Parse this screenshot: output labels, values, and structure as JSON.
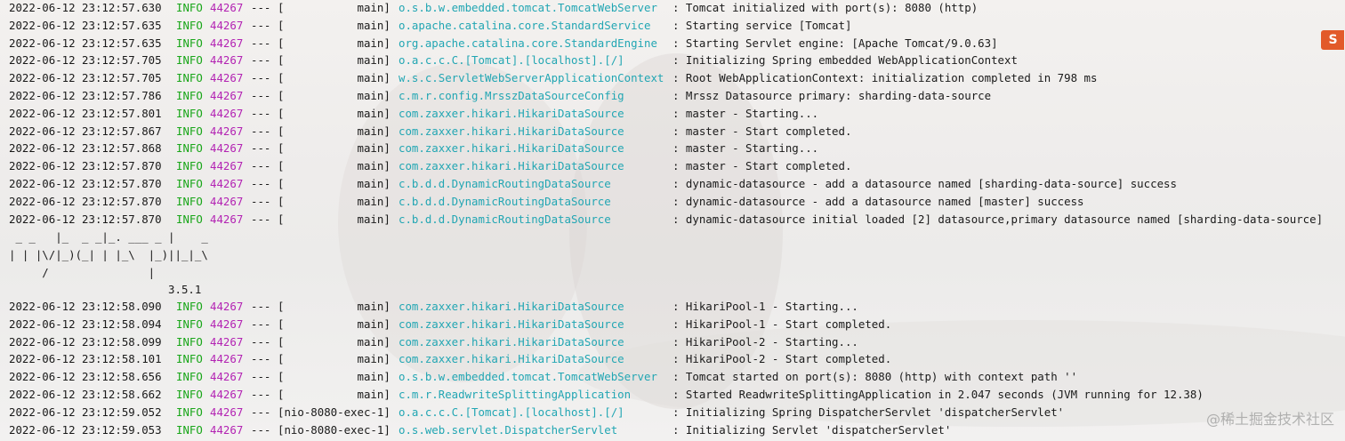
{
  "log_lines_top": [
    {
      "ts": "2022-06-12 23:12:57.630",
      "level": "INFO",
      "pid": "44267",
      "sep": "---",
      "thread": "[           main]",
      "logger": "o.s.b.w.embedded.tomcat.TomcatWebServer",
      "msg": ": Tomcat initialized with port(s): 8080 (http)"
    },
    {
      "ts": "2022-06-12 23:12:57.635",
      "level": "INFO",
      "pid": "44267",
      "sep": "---",
      "thread": "[           main]",
      "logger": "o.apache.catalina.core.StandardService",
      "msg": ": Starting service [Tomcat]"
    },
    {
      "ts": "2022-06-12 23:12:57.635",
      "level": "INFO",
      "pid": "44267",
      "sep": "---",
      "thread": "[           main]",
      "logger": "org.apache.catalina.core.StandardEngine",
      "msg": ": Starting Servlet engine: [Apache Tomcat/9.0.63]"
    },
    {
      "ts": "2022-06-12 23:12:57.705",
      "level": "INFO",
      "pid": "44267",
      "sep": "---",
      "thread": "[           main]",
      "logger": "o.a.c.c.C.[Tomcat].[localhost].[/]",
      "msg": ": Initializing Spring embedded WebApplicationContext"
    },
    {
      "ts": "2022-06-12 23:12:57.705",
      "level": "INFO",
      "pid": "44267",
      "sep": "---",
      "thread": "[           main]",
      "logger": "w.s.c.ServletWebServerApplicationContext",
      "msg": ": Root WebApplicationContext: initialization completed in 798 ms"
    },
    {
      "ts": "2022-06-12 23:12:57.786",
      "level": "INFO",
      "pid": "44267",
      "sep": "---",
      "thread": "[           main]",
      "logger": "c.m.r.config.MrsszDataSourceConfig",
      "msg": ": Mrssz Datasource primary: sharding-data-source"
    },
    {
      "ts": "2022-06-12 23:12:57.801",
      "level": "INFO",
      "pid": "44267",
      "sep": "---",
      "thread": "[           main]",
      "logger": "com.zaxxer.hikari.HikariDataSource",
      "msg": ": master - Starting..."
    },
    {
      "ts": "2022-06-12 23:12:57.867",
      "level": "INFO",
      "pid": "44267",
      "sep": "---",
      "thread": "[           main]",
      "logger": "com.zaxxer.hikari.HikariDataSource",
      "msg": ": master - Start completed."
    },
    {
      "ts": "2022-06-12 23:12:57.868",
      "level": "INFO",
      "pid": "44267",
      "sep": "---",
      "thread": "[           main]",
      "logger": "com.zaxxer.hikari.HikariDataSource",
      "msg": ": master - Starting..."
    },
    {
      "ts": "2022-06-12 23:12:57.870",
      "level": "INFO",
      "pid": "44267",
      "sep": "---",
      "thread": "[           main]",
      "logger": "com.zaxxer.hikari.HikariDataSource",
      "msg": ": master - Start completed."
    },
    {
      "ts": "2022-06-12 23:12:57.870",
      "level": "INFO",
      "pid": "44267",
      "sep": "---",
      "thread": "[           main]",
      "logger": "c.b.d.d.DynamicRoutingDataSource",
      "msg": ": dynamic-datasource - add a datasource named [sharding-data-source] success"
    },
    {
      "ts": "2022-06-12 23:12:57.870",
      "level": "INFO",
      "pid": "44267",
      "sep": "---",
      "thread": "[           main]",
      "logger": "c.b.d.d.DynamicRoutingDataSource",
      "msg": ": dynamic-datasource - add a datasource named [master] success"
    },
    {
      "ts": "2022-06-12 23:12:57.870",
      "level": "INFO",
      "pid": "44267",
      "sep": "---",
      "thread": "[           main]",
      "logger": "c.b.d.d.DynamicRoutingDataSource",
      "msg": ": dynamic-datasource initial loaded [2] datasource,primary datasource named [sharding-data-source]"
    }
  ],
  "banner": {
    "line1": " _ _   |_  _ _|_. ___ _ |    _",
    "line2": "| | |\\/|_)(_| | |_\\  |_)||_|_\\",
    "line3": "     /               |",
    "version": "                        3.5.1"
  },
  "log_lines_bottom": [
    {
      "ts": "2022-06-12 23:12:58.090",
      "level": "INFO",
      "pid": "44267",
      "sep": "---",
      "thread": "[           main]",
      "logger": "com.zaxxer.hikari.HikariDataSource",
      "msg": ": HikariPool-1 - Starting..."
    },
    {
      "ts": "2022-06-12 23:12:58.094",
      "level": "INFO",
      "pid": "44267",
      "sep": "---",
      "thread": "[           main]",
      "logger": "com.zaxxer.hikari.HikariDataSource",
      "msg": ": HikariPool-1 - Start completed."
    },
    {
      "ts": "2022-06-12 23:12:58.099",
      "level": "INFO",
      "pid": "44267",
      "sep": "---",
      "thread": "[           main]",
      "logger": "com.zaxxer.hikari.HikariDataSource",
      "msg": ": HikariPool-2 - Starting..."
    },
    {
      "ts": "2022-06-12 23:12:58.101",
      "level": "INFO",
      "pid": "44267",
      "sep": "---",
      "thread": "[           main]",
      "logger": "com.zaxxer.hikari.HikariDataSource",
      "msg": ": HikariPool-2 - Start completed."
    },
    {
      "ts": "2022-06-12 23:12:58.656",
      "level": "INFO",
      "pid": "44267",
      "sep": "---",
      "thread": "[           main]",
      "logger": "o.s.b.w.embedded.tomcat.TomcatWebServer",
      "msg": ": Tomcat started on port(s): 8080 (http) with context path ''"
    },
    {
      "ts": "2022-06-12 23:12:58.662",
      "level": "INFO",
      "pid": "44267",
      "sep": "---",
      "thread": "[           main]",
      "logger": "c.m.r.ReadwriteSplittingApplication",
      "msg": ": Started ReadwriteSplittingApplication in 2.047 seconds (JVM running for 12.38)"
    },
    {
      "ts": "2022-06-12 23:12:59.052",
      "level": "INFO",
      "pid": "44267",
      "sep": "---",
      "thread": "[nio-8080-exec-1]",
      "logger": "o.a.c.c.C.[Tomcat].[localhost].[/]",
      "msg": ": Initializing Spring DispatcherServlet 'dispatcherServlet'"
    },
    {
      "ts": "2022-06-12 23:12:59.053",
      "level": "INFO",
      "pid": "44267",
      "sep": "---",
      "thread": "[nio-8080-exec-1]",
      "logger": "o.s.web.servlet.DispatcherServlet",
      "msg": ": Initializing Servlet 'dispatcherServlet'"
    }
  ],
  "ime_icon": {
    "label": "S",
    "icon": "sogou-ime-icon"
  },
  "watermark": {
    "text": "@稀土掘金技术社区"
  },
  "colors": {
    "level": "#19a619",
    "pid": "#b323b3",
    "logger": "#22a6b3",
    "text": "#1a1a1a"
  }
}
